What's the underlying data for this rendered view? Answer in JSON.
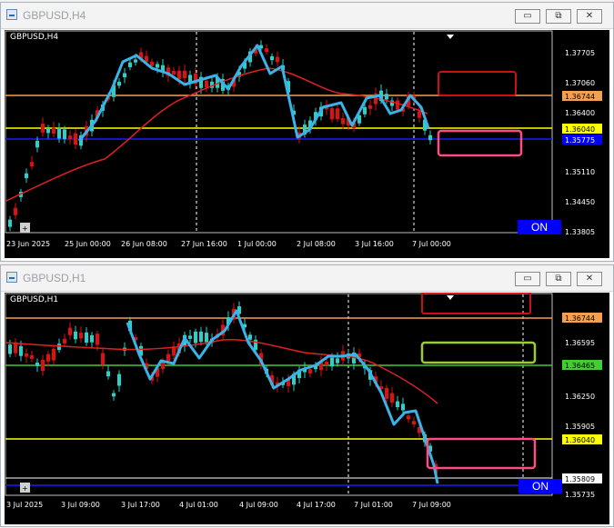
{
  "windows": [
    {
      "title": "GBPUSD,H4",
      "symbol_label": "GBPUSD,H4",
      "price_labels": [
        "1.37705",
        "1.37060",
        "1.36400",
        "1.35750",
        "1.35110",
        "1.34450",
        "1.33805"
      ],
      "time_labels": [
        "23 Jun 2025",
        "25 Jun 00:00",
        "26 Jun 08:00",
        "27 Jun 16:00",
        "1 Jul 00:00",
        "2 Jul 08:00",
        "3 Jul 16:00",
        "7 Jul 00:00"
      ],
      "level_labels": [
        {
          "text": "1.36744",
          "color": "#f5a050"
        },
        {
          "text": "1.36040",
          "color": "#ffff00"
        },
        {
          "text": "1.35775",
          "color": "#0000ff"
        }
      ],
      "on_button": "ON",
      "colors": {
        "candle_up": "#2bd0c9",
        "candle_down": "#e01010",
        "ma": "#e02020",
        "zigzag": "#3ab3e8",
        "orange_line": "#f5a050",
        "yellow_line": "#ffff00",
        "blue_line": "#1a1aff"
      }
    },
    {
      "title": "GBPUSD,H1",
      "symbol_label": "GBPUSD,H1",
      "price_labels": [
        "1.36595",
        "1.36250",
        "1.35905",
        "1.35735"
      ],
      "time_labels": [
        "3 Jul 2025",
        "3 Jul 09:00",
        "3 Jul 17:00",
        "4 Jul 01:00",
        "4 Jul 09:00",
        "4 Jul 17:00",
        "7 Jul 01:00",
        "7 Jul 09:00"
      ],
      "level_labels": [
        {
          "text": "1.36744",
          "color": "#f5a050"
        },
        {
          "text": "1.36465",
          "color": "#66dd44"
        },
        {
          "text": "1.36040",
          "color": "#ffff00"
        },
        {
          "text": "1.35809",
          "color": "#ffffff"
        }
      ],
      "on_button": "ON",
      "colors": {
        "candle_up": "#2bd0c9",
        "candle_down": "#e01010",
        "ma": "#e02020",
        "zigzag": "#3ab3e8",
        "orange_line": "#f5a050",
        "green_line": "#44cc33",
        "yellow_line": "#ffff00",
        "blue_line": "#1a1aff"
      }
    }
  ],
  "window_buttons": {
    "minimize": "▭",
    "restore": "⧉",
    "close": "✕"
  }
}
